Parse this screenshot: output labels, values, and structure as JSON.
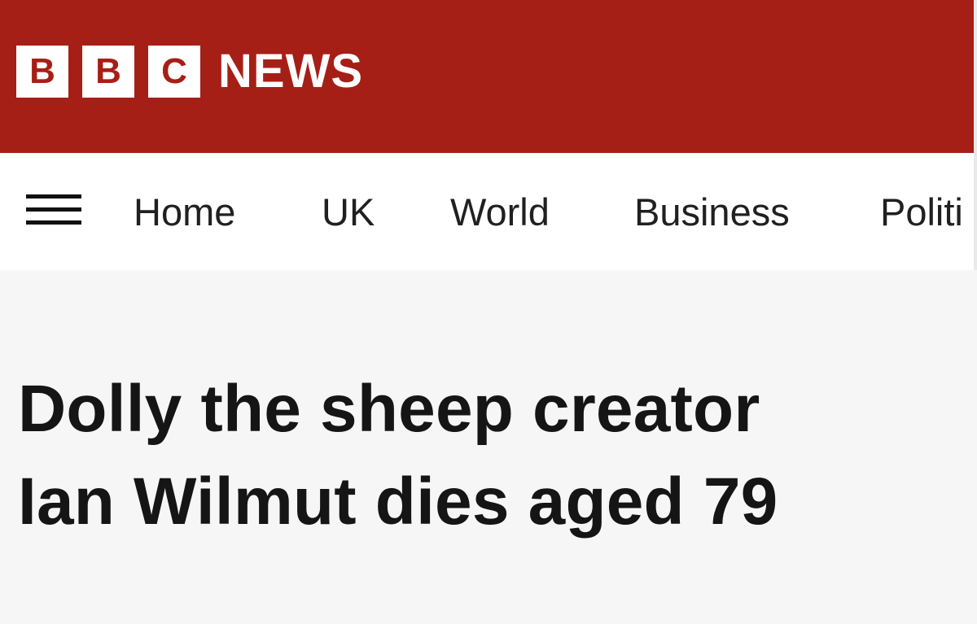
{
  "brand": {
    "logo_letters": [
      "B",
      "B",
      "C"
    ],
    "news_label": "NEWS",
    "colors": {
      "masthead": "#a61f16",
      "logo_block": "#ffffff",
      "nav_background": "#ffffff",
      "page_background": "#f6f6f6",
      "headline_text": "#151515"
    }
  },
  "nav": {
    "menu_icon": "hamburger-menu-icon",
    "items": [
      "Home",
      "UK",
      "World",
      "Business",
      "Politi"
    ]
  },
  "article": {
    "headline_lines": [
      "Dolly the sheep creator",
      "Ian Wilmut dies aged 79"
    ]
  }
}
